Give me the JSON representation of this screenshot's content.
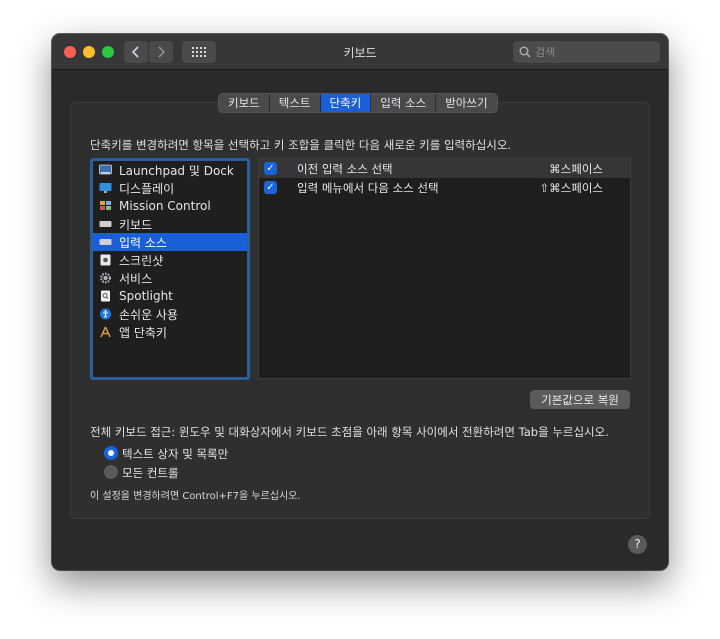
{
  "window": {
    "title": "키보드"
  },
  "search": {
    "placeholder": "검색"
  },
  "tabs": [
    {
      "label": "키보드",
      "active": false
    },
    {
      "label": "텍스트",
      "active": false
    },
    {
      "label": "단축키",
      "active": true
    },
    {
      "label": "입력 소스",
      "active": false
    },
    {
      "label": "받아쓰기",
      "active": false
    }
  ],
  "instruction": "단축키를 변경하려면 항목을 선택하고 키 조합을 클릭한 다음 새로운 키를 입력하십시오.",
  "categories": [
    {
      "label": "Launchpad 및 Dock",
      "icon": "launchpad-dock-icon"
    },
    {
      "label": "디스플레이",
      "icon": "display-icon"
    },
    {
      "label": "Mission Control",
      "icon": "mission-control-icon"
    },
    {
      "label": "키보드",
      "icon": "keyboard-icon"
    },
    {
      "label": "입력 소스",
      "icon": "input-source-icon",
      "selected": true
    },
    {
      "label": "스크린샷",
      "icon": "screenshot-icon"
    },
    {
      "label": "서비스",
      "icon": "services-gear-icon"
    },
    {
      "label": "Spotlight",
      "icon": "spotlight-icon"
    },
    {
      "label": "손쉬운 사용",
      "icon": "accessibility-icon"
    },
    {
      "label": "앱 단축키",
      "icon": "app-shortcuts-icon"
    }
  ],
  "shortcuts": [
    {
      "name": "이전 입력 소스 선택",
      "keys": "⌘스페이스",
      "checked": true
    },
    {
      "name": "입력 메뉴에서 다음 소스 선택",
      "keys": "⇧⌘스페이스",
      "checked": true
    }
  ],
  "restore_button": "기본값으로 복원",
  "access": {
    "text": "전체 키보드 접근: 윈도우 및 대화상자에서 키보드 초점을 아래 항목 사이에서 전환하려면 Tab을 누르십시오.",
    "options": [
      {
        "label": "텍스트 상자 및 목록만",
        "selected": true
      },
      {
        "label": "모든 컨트롤",
        "selected": false
      }
    ],
    "note": "이 설정을 변경하려면 Control+F7을 누르십시오."
  },
  "help_label": "?",
  "colors": {
    "accent": "#1a5fd7",
    "window_bg": "#2a2a2b",
    "list_bg": "#1f1f20"
  }
}
